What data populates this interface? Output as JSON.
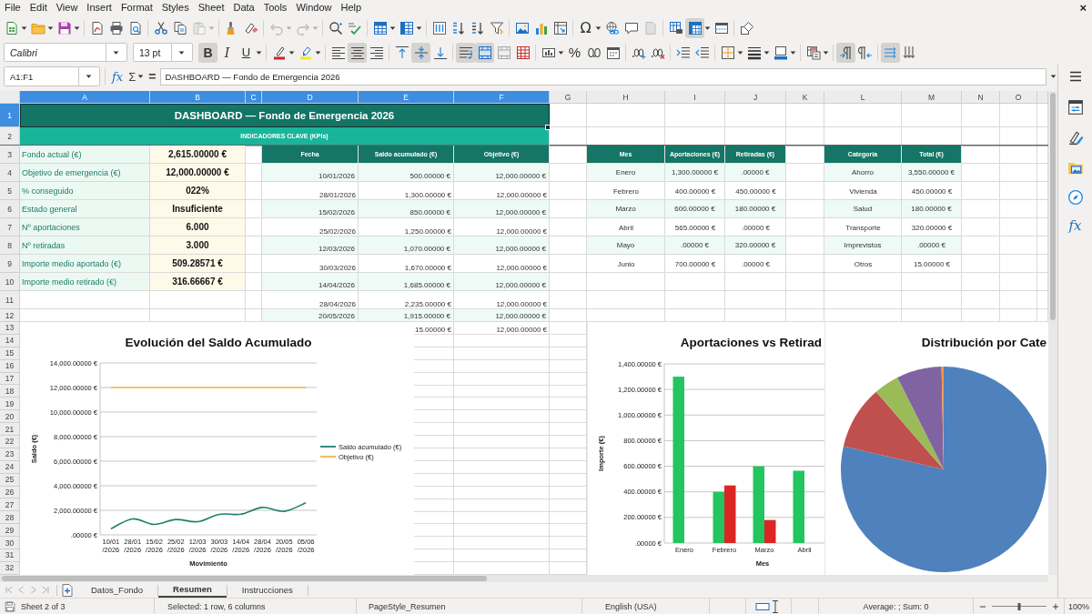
{
  "menu_bar": {
    "items": [
      "File",
      "Edit",
      "View",
      "Insert",
      "Format",
      "Styles",
      "Sheet",
      "Data",
      "Tools",
      "Window",
      "Help"
    ],
    "close": "×"
  },
  "standard_toolbar": {
    "paste_disabled": true,
    "undo_disabled": true,
    "redo_disabled": true,
    "special_character": "Ω",
    "freeze_pressed": true
  },
  "formatting_toolbar": {
    "font_name": "Calibri",
    "font_size": "13 pt",
    "bold": {
      "label": "B",
      "pressed": true
    },
    "italic": {
      "label": "I",
      "pressed": false
    },
    "underline": {
      "label": "U",
      "pressed": false
    },
    "align_left": false,
    "align_center": true,
    "align_right": false,
    "align_top": false,
    "align_middle": true,
    "align_bottom": false,
    "wrap_text": true,
    "merge_and_center": true,
    "percent": "%",
    "left_to_right": true,
    "right_to_left": false,
    "text_horizontal": true,
    "text_vertical": false
  },
  "formula_bar": {
    "name_box": "A1:F1",
    "function_wizard": "fx",
    "sum": "Σ",
    "equals": "=",
    "content": "DASHBOARD — Fondo de Emergencia 2026"
  },
  "sidebar": {
    "functions": "fx"
  },
  "sheet": {
    "columns": [
      {
        "label": "A",
        "selected": true
      },
      {
        "label": "B",
        "selected": true
      },
      {
        "label": "C",
        "selected": true
      },
      {
        "label": "D",
        "selected": true
      },
      {
        "label": "E",
        "selected": true
      },
      {
        "label": "F",
        "selected": true
      },
      {
        "label": "G",
        "selected": false
      },
      {
        "label": "H",
        "selected": false
      },
      {
        "label": "I",
        "selected": false
      },
      {
        "label": "J",
        "selected": false
      },
      {
        "label": "K",
        "selected": false
      },
      {
        "label": "L",
        "selected": false
      },
      {
        "label": "M",
        "selected": false
      },
      {
        "label": "N",
        "selected": false
      },
      {
        "label": "O",
        "selected": false
      }
    ],
    "rows": [
      {
        "label": "1",
        "selected": true
      },
      {
        "label": "2",
        "selected": false
      },
      {
        "label": "3",
        "selected": false
      },
      {
        "label": "4",
        "selected": false
      },
      {
        "label": "5",
        "selected": false
      },
      {
        "label": "6",
        "selected": false
      },
      {
        "label": "7",
        "selected": false
      },
      {
        "label": "8",
        "selected": false
      },
      {
        "label": "9",
        "selected": false
      },
      {
        "label": "10",
        "selected": false
      },
      {
        "label": "11",
        "selected": false
      },
      {
        "label": "12",
        "selected": false
      },
      {
        "label": "13",
        "selected": false
      },
      {
        "label": "14",
        "selected": false
      },
      {
        "label": "15",
        "selected": false
      },
      {
        "label": "16",
        "selected": false
      },
      {
        "label": "17",
        "selected": false
      },
      {
        "label": "18",
        "selected": false
      },
      {
        "label": "19",
        "selected": false
      },
      {
        "label": "20",
        "selected": false
      },
      {
        "label": "21",
        "selected": false
      },
      {
        "label": "22",
        "selected": false
      },
      {
        "label": "23",
        "selected": false
      },
      {
        "label": "24",
        "selected": false
      },
      {
        "label": "25",
        "selected": false
      },
      {
        "label": "26",
        "selected": false
      },
      {
        "label": "27",
        "selected": false
      },
      {
        "label": "28",
        "selected": false
      },
      {
        "label": "29",
        "selected": false
      },
      {
        "label": "30",
        "selected": false
      },
      {
        "label": "31",
        "selected": false
      },
      {
        "label": "32",
        "selected": false
      }
    ],
    "title_cell": {
      "text": "DASHBOARD — Fondo de Emergencia 2026",
      "selected": true
    },
    "subtitle": "INDICADORES CLAVE (KPIs)",
    "kpis": [
      {
        "label": "Fondo actual (€)",
        "value": "2,615.00000 €"
      },
      {
        "label": "Objetivo de emergencia (€)",
        "value": "12,000.00000 €"
      },
      {
        "label": "% conseguido",
        "value": "022%"
      },
      {
        "label": "Estado general",
        "value": "Insuficiente"
      },
      {
        "label": "Nº aportaciones",
        "value": "6.000"
      },
      {
        "label": "Nº retiradas",
        "value": "3.000"
      },
      {
        "label": "Importe medio aportado (€)",
        "value": "509.28571 €"
      },
      {
        "label": "Importe medio retirado (€)",
        "value": "316.66667 €"
      }
    ],
    "movements": {
      "columns": [
        "Fecha",
        "Saldo acumulado (€)",
        "Objetivo (€)"
      ],
      "rows": [
        {
          "date": "10/01/2026",
          "balance": "500.00000 €",
          "target": "12,000.00000 €"
        },
        {
          "date": "28/01/2026",
          "balance": "1,300.00000 €",
          "target": "12,000.00000 €"
        },
        {
          "date": "15/02/2026",
          "balance": "850.00000 €",
          "target": "12,000.00000 €"
        },
        {
          "date": "25/02/2026",
          "balance": "1,250.00000 €",
          "target": "12,000.00000 €"
        },
        {
          "date": "12/03/2026",
          "balance": "1,070.00000 €",
          "target": "12,000.00000 €"
        },
        {
          "date": "30/03/2026",
          "balance": "1,670.00000 €",
          "target": "12,000.00000 €"
        },
        {
          "date": "14/04/2026",
          "balance": "1,685.00000 €",
          "target": "12,000.00000 €"
        },
        {
          "date": "28/04/2026",
          "balance": "2,235.00000 €",
          "target": "12,000.00000 €"
        },
        {
          "date": "20/05/2026",
          "balance": "1,915.00000 €",
          "target": "12,000.00000 €"
        },
        {
          "balance": "15.00000 €",
          "target": "12,000.00000 €"
        }
      ]
    },
    "monthly": {
      "columns": [
        "Mes",
        "Aportaciones (€)",
        "Retiradas (€)"
      ],
      "rows": [
        {
          "month": "Enero",
          "contributions": "1,300.00000 €",
          "withdrawals": ".00000 €"
        },
        {
          "month": "Febrero",
          "contributions": "400.00000 €",
          "withdrawals": "450.00000 €"
        },
        {
          "month": "Marzo",
          "contributions": "600.00000 €",
          "withdrawals": "180.00000 €"
        },
        {
          "month": "Abril",
          "contributions": "565.00000 €",
          "withdrawals": ".00000 €"
        },
        {
          "month": "Mayo",
          "contributions": ".00000 €",
          "withdrawals": "320.00000 €"
        },
        {
          "month": "Junio",
          "contributions": "700.00000 €",
          "withdrawals": ".00000 €"
        }
      ]
    },
    "categories": {
      "columns": [
        "Categoría",
        "Total (€)"
      ],
      "rows": [
        {
          "category": "Ahorro",
          "total": "3,550.00000 €"
        },
        {
          "category": "Vivienda",
          "total": "450.00000 €"
        },
        {
          "category": "Salud",
          "total": "180.00000 €"
        },
        {
          "category": "Transporte",
          "total": "320.00000 €"
        },
        {
          "category": "Imprevistos",
          "total": ".00000 €"
        },
        {
          "category": "Otros",
          "total": "15.00000 €"
        }
      ]
    },
    "charts": [
      {
        "chart_data": {
          "type": "line",
          "title": "Evolución del Saldo Acumulado",
          "xlabel": "Movimiento",
          "ylabel": "Saldo (€)",
          "categories": [
            "10/01\n/2026",
            "28/01\n/2026",
            "15/02\n/2026",
            "25/02\n/2026",
            "12/03\n/2026",
            "30/03\n/2026",
            "14/04\n/2026",
            "28/04\n/2026",
            "20/05\n/2026",
            "05/06\n/2026"
          ],
          "series": [
            {
              "name": "Saldo acumulado (€)",
              "color": "#1e7f6e",
              "values": [
                500,
                1300,
                850,
                1250,
                1070,
                1670,
                1685,
                2235,
                1915,
                2615
              ]
            },
            {
              "name": "Objetivo (€)",
              "color": "#f0b84a",
              "values": [
                12000,
                12000,
                12000,
                12000,
                12000,
                12000,
                12000,
                12000,
                12000,
                12000
              ]
            }
          ],
          "ylim": [
            0,
            14000
          ],
          "yticks": [
            {
              "value": 0,
              "label": ".00000 €"
            },
            {
              "value": 2000,
              "label": "2,000.00000 €"
            },
            {
              "value": 4000,
              "label": "4,000.00000 €"
            },
            {
              "value": 6000,
              "label": "6,000.00000 €"
            },
            {
              "value": 8000,
              "label": "8,000.00000 €"
            },
            {
              "value": 10000,
              "label": "10,000.00000 €"
            },
            {
              "value": 12000,
              "label": "12,000.00000 €"
            },
            {
              "value": 14000,
              "label": "14,000.00000 €"
            }
          ],
          "grid": true,
          "legend": "right"
        }
      },
      {
        "chart_data": {
          "type": "bar",
          "title": "Aportaciones vs Retirad",
          "xlabel": "Mes",
          "ylabel": "Importe (€)",
          "categories": [
            "Enero",
            "Febrero",
            "Marzo",
            "Abril"
          ],
          "series": [
            {
              "color": "#22c55e",
              "values": [
                1300,
                400,
                600,
                565
              ]
            },
            {
              "color": "#dc2626",
              "values": [
                0,
                450,
                180,
                0
              ]
            }
          ],
          "ylim": [
            0,
            1400
          ],
          "yticks": [
            {
              "value": 0,
              "label": ".00000 €"
            },
            {
              "value": 200,
              "label": "200.00000 €"
            },
            {
              "value": 400,
              "label": "400.00000 €"
            },
            {
              "value": 600,
              "label": "600.00000 €"
            },
            {
              "value": 800,
              "label": "800.00000 €"
            },
            {
              "value": 1000,
              "label": "1,000.00000 €"
            },
            {
              "value": 1200,
              "label": "1,200.00000 €"
            },
            {
              "value": 1400,
              "label": "1,400.00000 €"
            }
          ],
          "grid": true
        }
      },
      {
        "chart_data": {
          "type": "pie",
          "title": "Distribución por Cate",
          "values": [
            78.62,
            9.97,
            3.99,
            7.09,
            0.33
          ],
          "colors": [
            "#4f81bd",
            "#c0504d",
            "#9bbb59",
            "#8064a2",
            "#f79646"
          ]
        }
      }
    ]
  },
  "sheet_tabs": {
    "tabs": [
      {
        "label": "Datos_Fondo",
        "selected": false
      },
      {
        "label": "Resumen",
        "selected": true
      },
      {
        "label": "Instrucciones",
        "selected": false
      }
    ]
  },
  "status_bar": {
    "sheet": "Sheet 2 of 3",
    "selection": "Selected: 1 row, 6 columns",
    "page_style": "PageStyle_Resumen",
    "language": "English (USA)",
    "summary": "Average: ; Sum: 0",
    "zoom": {
      "level": 0.5,
      "reading": "100%"
    }
  }
}
